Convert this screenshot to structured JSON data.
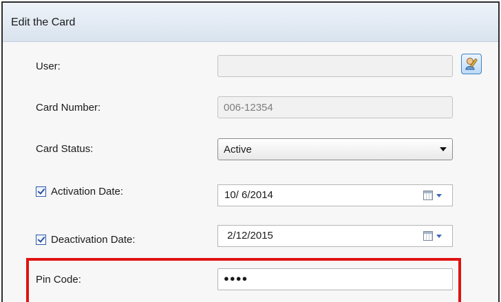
{
  "dialog": {
    "title": "Edit the Card"
  },
  "user": {
    "label": "User:",
    "value": ""
  },
  "card_number": {
    "label": "Card Number:",
    "value": "006-12354"
  },
  "card_status": {
    "label": "Card Status:",
    "value": "Active"
  },
  "activation_date": {
    "label": "Activation Date:",
    "value": "10/ 6/2014",
    "checked": true
  },
  "deactivation_date": {
    "label": "Deactivation Date:",
    "value": " 2/12/2015",
    "checked": true
  },
  "pin_code": {
    "label": "Pin Code:",
    "value": "●●●●"
  },
  "icons": {
    "user_picker": "user-picker-icon",
    "calendar": "calendar-icon"
  },
  "colors": {
    "highlight": "#e01212",
    "title_bar": "#dde6f0"
  }
}
